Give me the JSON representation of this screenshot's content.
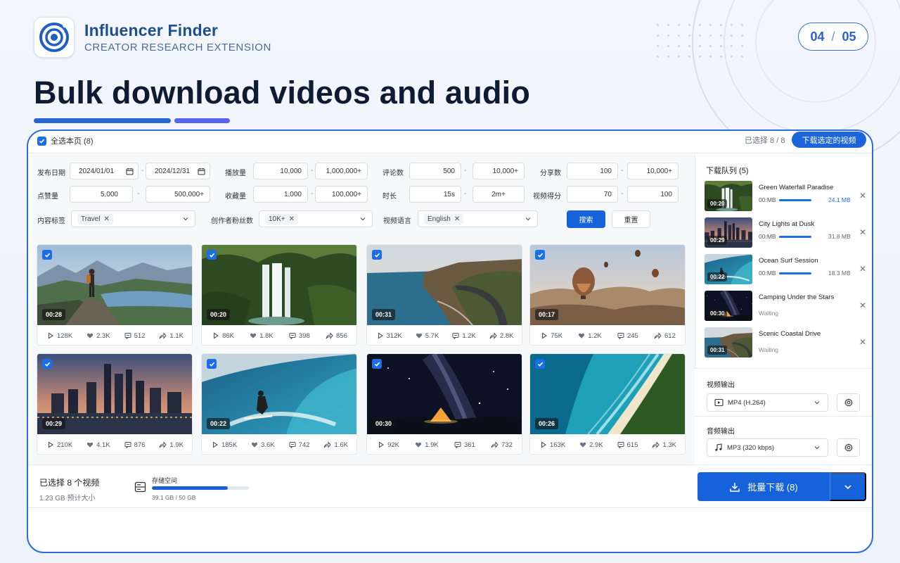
{
  "brand": {
    "name": "Influencer Finder",
    "subtitle": "CREATOR RESEARCH EXTENSION"
  },
  "pager": {
    "current": "04",
    "separator": "/",
    "total": "05"
  },
  "headline": "Bulk download videos and audio",
  "colors": {
    "primary": "#1662db",
    "accent": "#5a63f0",
    "headline": "#0f1b33",
    "brand": "#1e4e8c"
  },
  "topbar": {
    "select_all_label": "全选本页 (8)",
    "selected_count": "已选择 8 / 8",
    "download_selected": "下载选定的视频"
  },
  "filters": {
    "publish_date": {
      "label": "发布日期",
      "from": "2024/01/01",
      "to": "2024/12/31"
    },
    "plays": {
      "label": "播放量",
      "min": "10,000",
      "max": "1,000,000+"
    },
    "comments": {
      "label": "评论数",
      "min": "500",
      "max": "10,000+"
    },
    "shares": {
      "label": "分享数",
      "min": "100",
      "max": "10,000+"
    },
    "likes": {
      "label": "点赞量",
      "min": "5,000",
      "max": "500,000+"
    },
    "saves": {
      "label": "收藏量",
      "min": "1,000",
      "max": "100,000+"
    },
    "duration": {
      "label": "时长",
      "min": "15s",
      "max": "2m+"
    },
    "score": {
      "label": "视频得分",
      "min": "70",
      "max": "100"
    },
    "content_tags": {
      "label": "内容标签",
      "value": "Travel"
    },
    "followers": {
      "label": "创作者粉丝数",
      "value": "10K+"
    },
    "language": {
      "label": "视频语言",
      "value": "English"
    },
    "dash": "-",
    "search_label": "搜索",
    "reset_label": "重置"
  },
  "videos": [
    {
      "duration": "00:28",
      "plays": "128K",
      "likes": "2.3K",
      "comments": "512",
      "shares": "1.1K"
    },
    {
      "duration": "00:20",
      "plays": "86K",
      "likes": "1.8K",
      "comments": "398",
      "shares": "856"
    },
    {
      "duration": "00:31",
      "plays": "312K",
      "likes": "5.7K",
      "comments": "1.2K",
      "shares": "2.8K"
    },
    {
      "duration": "00:17",
      "plays": "75K",
      "likes": "1.2K",
      "comments": "245",
      "shares": "612"
    },
    {
      "duration": "00:29",
      "plays": "210K",
      "likes": "4.1K",
      "comments": "876",
      "shares": "1.9K"
    },
    {
      "duration": "00:22",
      "plays": "185K",
      "likes": "3.6K",
      "comments": "742",
      "shares": "1.6K"
    },
    {
      "duration": "00:30",
      "plays": "92K",
      "likes": "1.9K",
      "comments": "361",
      "shares": "732"
    },
    {
      "duration": "00:26",
      "plays": "163K",
      "likes": "2.9K",
      "comments": "615",
      "shares": "1.3K"
    }
  ],
  "queue": {
    "title": "下载队列 (5)",
    "items": [
      {
        "name": "Green Waterfall Paradise",
        "duration": "00:20",
        "progress": "00:MB",
        "size": "24.1 MB",
        "status": "active"
      },
      {
        "name": "City Lights at Dusk",
        "duration": "00:29",
        "progress": "00:MB",
        "size": "31.8 MB",
        "status": "downloading"
      },
      {
        "name": "Ocean Surf Session",
        "duration": "00:22",
        "progress": "00:MB",
        "size": "18.3 MB",
        "status": "downloading"
      },
      {
        "name": "Camping Under the Stars",
        "duration": "00:30",
        "status_text": "Waiting"
      },
      {
        "name": "Scenic Coastal Drive",
        "duration": "00:31",
        "status_text": "Waiting"
      }
    ]
  },
  "output": {
    "video_label": "视频输出",
    "video_format": "MP4 (H.264)",
    "audio_label": "音频输出",
    "audio_format": "MP3 (320 kbps)"
  },
  "bottom": {
    "selected_summary": "已选择 8 个视频",
    "estimated_size": "1.23 GB 预计大小",
    "storage_label": "存储空间",
    "storage_text": "39.1 GB / 50 GB",
    "storage_used_fraction": 0.782,
    "bulk_download": "批量下载 (8)"
  }
}
